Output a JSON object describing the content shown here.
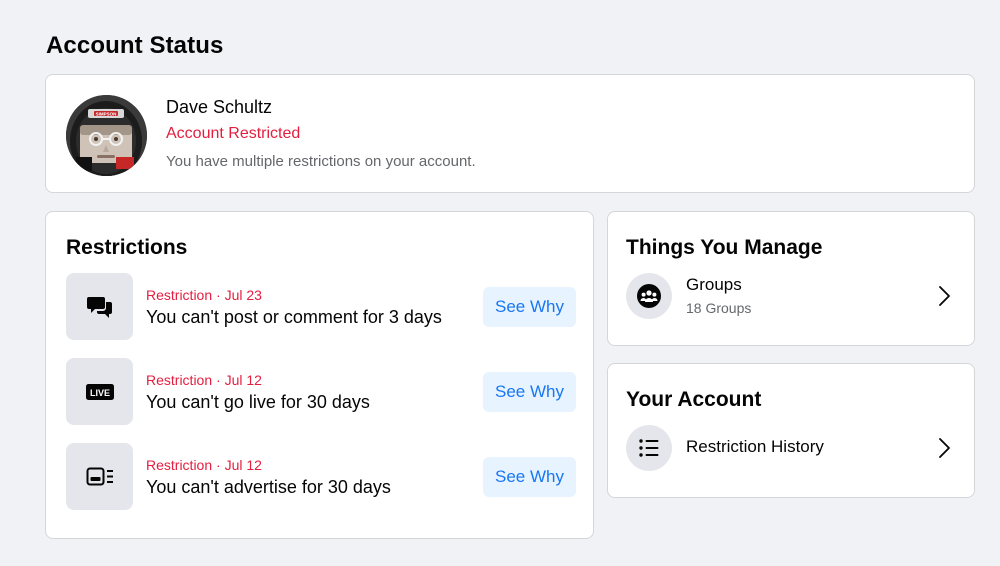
{
  "page": {
    "title": "Account Status"
  },
  "profile": {
    "name": "Dave Schultz",
    "status": "Account Restricted",
    "description": "You have multiple restrictions on your account.",
    "helmet_brand": "SIMPSON"
  },
  "restrictions": {
    "heading": "Restrictions",
    "items": [
      {
        "icon": "comments-icon",
        "meta": "Restriction · Jul 23",
        "title": "You can't post or comment for 3 days",
        "button": "See Why"
      },
      {
        "icon": "live-icon",
        "badge": "LIVE",
        "meta": "Restriction · Jul 12",
        "title": "You can't go live for 30 days",
        "button": "See Why"
      },
      {
        "icon": "ad-icon",
        "meta": "Restriction · Jul 12",
        "title": "You can't advertise for 30 days",
        "button": "See Why"
      }
    ]
  },
  "things_you_manage": {
    "heading": "Things You Manage",
    "items": [
      {
        "icon": "groups-icon",
        "title": "Groups",
        "subtitle": "18 Groups"
      }
    ]
  },
  "your_account": {
    "heading": "Your Account",
    "items": [
      {
        "icon": "list-icon",
        "title": "Restriction History"
      }
    ]
  },
  "colors": {
    "accent_blue": "#1877f2",
    "restricted_red": "#e41e3f",
    "secondary_text": "#65676b",
    "page_background": "#f0f2f5"
  }
}
